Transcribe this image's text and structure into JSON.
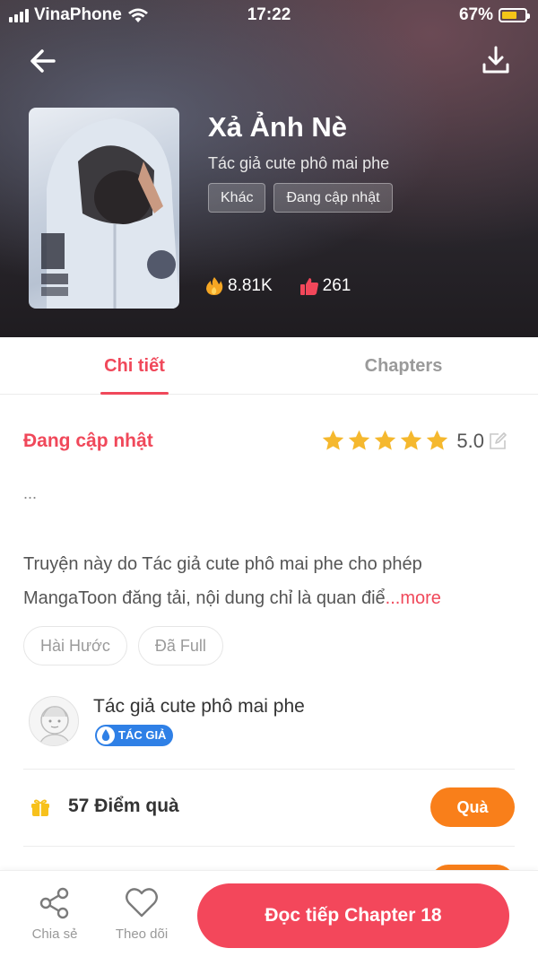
{
  "status_bar": {
    "carrier": "VinaPhone",
    "time": "17:22",
    "battery": "67%",
    "battery_level": 0.67
  },
  "header": {
    "title": "Xả Ảnh Nè",
    "author": "Tác giả cute phô mai phe",
    "tags": [
      "Khác",
      "Đang cập nhật"
    ],
    "views": "8.81K",
    "likes": "261"
  },
  "tabs": [
    {
      "label": "Chi tiết",
      "active": true
    },
    {
      "label": "Chapters",
      "active": false
    }
  ],
  "detail": {
    "status": "Đang cập nhật",
    "rating": {
      "value": "5.0",
      "stars": 5
    },
    "ellipsis": "...",
    "description_line1": "Truyện này do Tác giả cute phô mai phe cho phép",
    "description_line2": "MangaToon đăng tải, nội dung chỉ là quan điể",
    "more_label": "...more",
    "genres": [
      "Hài Hước",
      "Đã Full"
    ]
  },
  "author_card": {
    "name": "Tác giả cute phô mai phe",
    "badge": "TÁC GIẢ"
  },
  "gift": {
    "text": "57 Điểm quà",
    "button": "Quà"
  },
  "bottom_bar": {
    "share": "Chia sẻ",
    "follow": "Theo dõi",
    "read": "Đọc tiếp Chapter 18"
  },
  "colors": {
    "accent": "#f0485a",
    "orange": "#f97f1a",
    "badge_blue": "#2f80e6"
  }
}
